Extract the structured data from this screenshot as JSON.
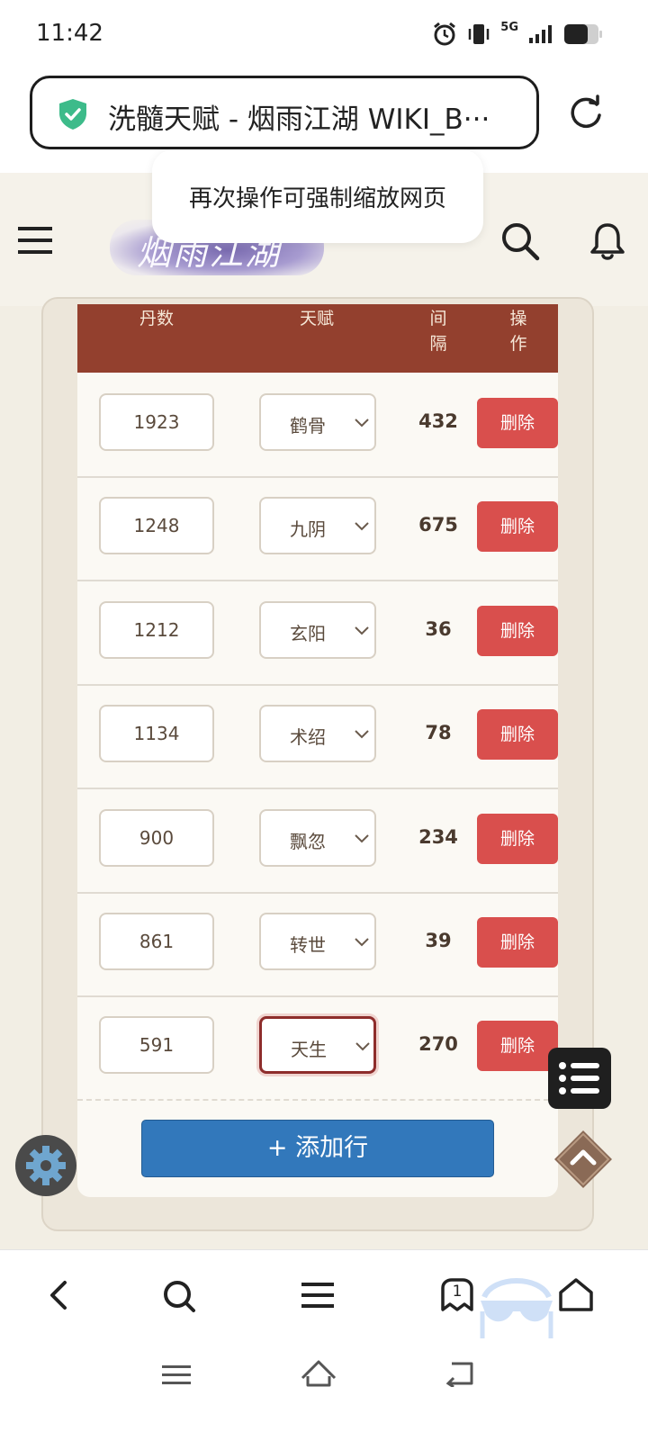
{
  "status_bar": {
    "time": "11:42",
    "network": "5G",
    "icons": [
      "alarm-icon",
      "vibrate-icon",
      "signal-icon",
      "battery-icon"
    ]
  },
  "browser": {
    "page_title": "洗髓天赋 - 烟雨江湖 WIKI_B···",
    "secure_icon": "shield-check-icon",
    "reload_icon": "reload-icon"
  },
  "toast": {
    "message": "再次操作可强制缩放网页"
  },
  "site_header": {
    "logo_text": "烟雨江湖",
    "icons": [
      "menu-icon",
      "search-icon",
      "bell-icon"
    ]
  },
  "table": {
    "headers": {
      "pills": "丹数",
      "talent": "天赋",
      "interval": "间\n隔",
      "action": "操\n作"
    },
    "rows": [
      {
        "pills": "1923",
        "talent": "鹤骨",
        "interval": "432",
        "action": "删除"
      },
      {
        "pills": "1248",
        "talent": "九阴",
        "interval": "675",
        "action": "删除"
      },
      {
        "pills": "1212",
        "talent": "玄阳",
        "interval": "36",
        "action": "删除"
      },
      {
        "pills": "1134",
        "talent": "术绍",
        "interval": "78",
        "action": "删除"
      },
      {
        "pills": "900",
        "talent": "飘忽",
        "interval": "234",
        "action": "删除"
      },
      {
        "pills": "861",
        "talent": "转世",
        "interval": "39",
        "action": "删除"
      },
      {
        "pills": "591",
        "talent": "天生",
        "interval": "270",
        "action": "删除"
      }
    ],
    "add_row_label": "+ 添加行"
  },
  "floating": {
    "settings_icon": "gear-icon",
    "toc_icon": "list-icon",
    "top_icon": "chevron-up-icon"
  },
  "browser_nav": {
    "tab_count": "1",
    "icons": [
      "back-icon",
      "search-icon",
      "menu-icon",
      "tabs-icon",
      "home-icon"
    ]
  },
  "colors": {
    "header_bg": "#93402e",
    "delete_button": "#d94f4d",
    "add_button": "#3278bb",
    "secure_green": "#3dbb8a"
  }
}
